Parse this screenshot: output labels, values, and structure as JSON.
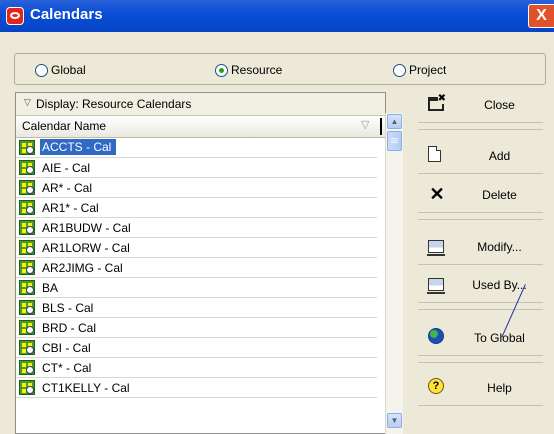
{
  "window": {
    "title": "Calendars",
    "close_symbol": "X"
  },
  "scope": {
    "options": [
      {
        "label": "Global",
        "checked": false
      },
      {
        "label": "Resource",
        "checked": true
      },
      {
        "label": "Project",
        "checked": false
      }
    ]
  },
  "list": {
    "display_label": "Display: Resource Calendars",
    "column_header": "Calendar Name",
    "rows": [
      "ACCTS - Cal",
      "AIE - Cal",
      "AR* - Cal",
      "AR1* - Cal",
      "AR1BUDW - Cal",
      "AR1LORW - Cal",
      "AR2JIMG - Cal",
      "BA",
      "BLS - Cal",
      "BRD - Cal",
      "CBI - Cal",
      "CT* - Cal",
      "CT1KELLY - Cal"
    ],
    "selected_index": 0
  },
  "buttons": {
    "close": "Close",
    "add": "Add",
    "delete": "Delete",
    "modify": "Modify...",
    "used_by": "Used By...",
    "to_global": "To Global",
    "help": "Help"
  },
  "colors": {
    "titlebar": "#0a4fd6",
    "selection": "#316ac5",
    "callout_line": "#1e2fb0"
  }
}
